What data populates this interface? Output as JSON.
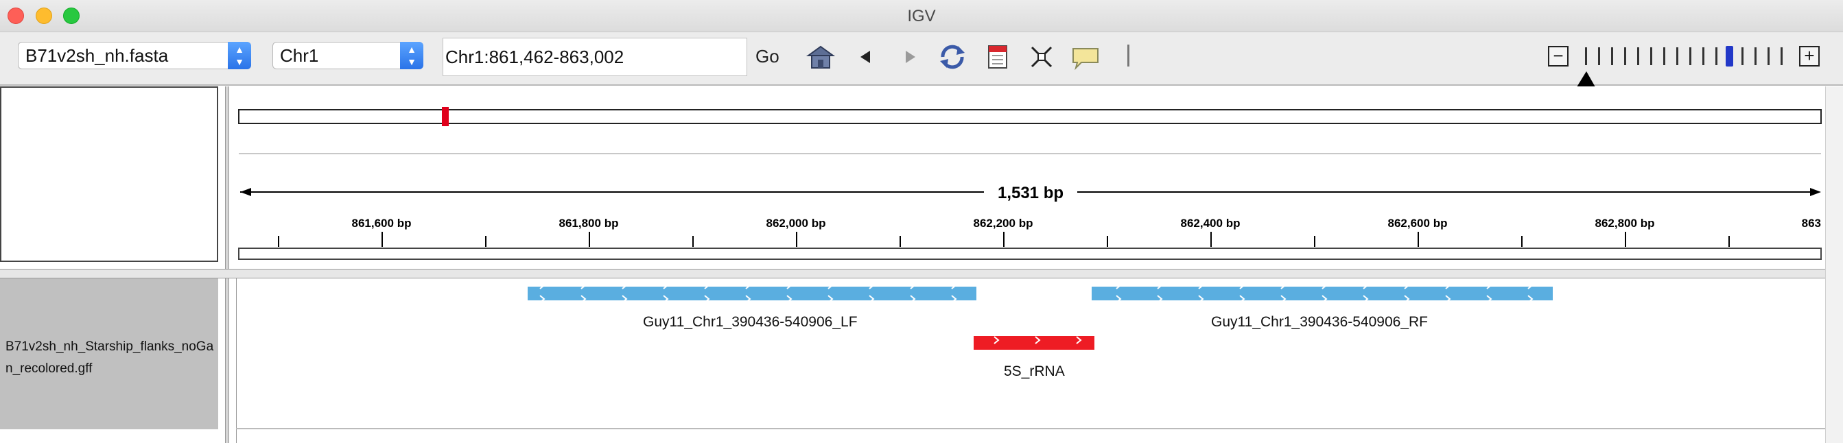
{
  "window": {
    "title": "IGV"
  },
  "toolbar": {
    "genome": "B71v2sh_nh.fasta",
    "chromosome": "Chr1",
    "locus": "Chr1:861,462-863,002",
    "go_label": "Go",
    "icons": [
      "home-icon",
      "back-icon",
      "forward-icon",
      "refresh-icon",
      "roi-icon",
      "resize-icon",
      "popup-info-icon"
    ]
  },
  "zoom": {
    "minus": "−",
    "plus": "+",
    "tick_count": 16,
    "current_level": 0.7
  },
  "ruler": {
    "span_label": "1,531 bp",
    "tick_labels": [
      "861,600 bp",
      "861,800 bp",
      "862,000 bp",
      "862,200 bp",
      "862,400 bp",
      "862,600 bp",
      "862,800 bp",
      "863"
    ]
  },
  "track": {
    "name": "B71v2sh_nh_Starship_flanks_noGan_recolored.gff",
    "features": [
      {
        "name": "Guy11_Chr1_390436-540906_LF",
        "color": "#5aaee0"
      },
      {
        "name": "Guy11_Chr1_390436-540906_RF",
        "color": "#5aaee0"
      },
      {
        "name": "5S_rRNA",
        "color": "#ee1c24"
      }
    ]
  },
  "colors": {
    "feature_blue": "#5aaee0",
    "feature_red": "#ee1c24",
    "chromosome_marker": "#e0001b"
  }
}
